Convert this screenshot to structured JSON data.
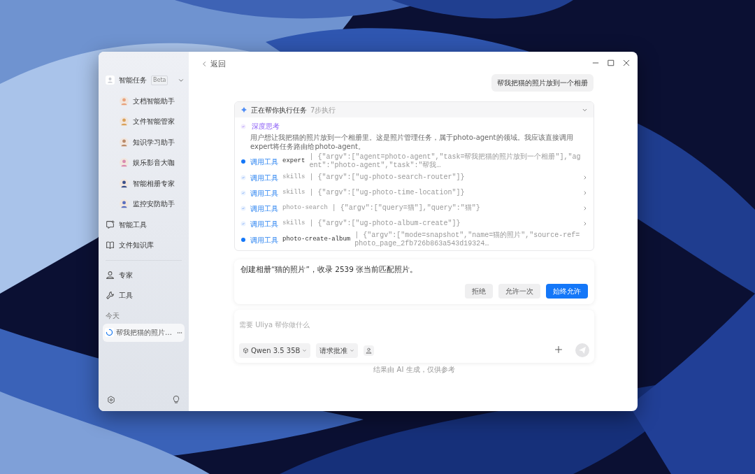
{
  "sidebar": {
    "header": {
      "label": "智能任务",
      "badge": "Beta",
      "expanded": true
    },
    "agents": [
      {
        "label": "文档智能助手",
        "color": "#e8a27c"
      },
      {
        "label": "文件智能管家",
        "color": "#d9a15a"
      },
      {
        "label": "知识学习助手",
        "color": "#b98a6a"
      },
      {
        "label": "娱乐影音大咖",
        "color": "#d98ab0"
      },
      {
        "label": "智能相册专家",
        "color": "#3a4f8a"
      },
      {
        "label": "监控安防助手",
        "color": "#5a6fc0"
      }
    ],
    "links": [
      {
        "kind": "tools",
        "label": "智能工具"
      },
      {
        "kind": "library",
        "label": "文件知识库"
      }
    ],
    "nav": [
      {
        "kind": "experts",
        "label": "专家"
      },
      {
        "kind": "wrench",
        "label": "工具"
      }
    ],
    "section_label": "今天",
    "history": [
      {
        "label": "帮我把猫的照片…",
        "loading": true,
        "selected": true
      }
    ]
  },
  "back": "返回",
  "user_message": "帮我把猫的照片放到一个相册",
  "task": {
    "title": "正在帮你执行任务",
    "subtitle": "7步执行",
    "expanded": true,
    "thought": {
      "label": "深度思考",
      "text": "用户想让我把猫的照片放到一个相册里。这是照片管理任务，属于photo-agent的领域。我应该直接调用expert将任务路由给photo-agent。"
    },
    "steps": [
      {
        "kind": "running",
        "label": "调用工具",
        "command": "expert",
        "args": "| {\"argv\":[\"agent=photo-agent\",\"task=帮我把猫的照片放到一个相册\"],\"agent\":\"photo-agent\",\"task\":\"帮我…",
        "expandable": false
      },
      {
        "kind": "done",
        "label": "调用工具",
        "command": "skills",
        "args": "| {\"argv\":[\"ug-photo-search-router\"]}",
        "expandable": true
      },
      {
        "kind": "done",
        "label": "调用工具",
        "command": "skills",
        "args": "| {\"argv\":[\"ug-photo-time-location\"]}",
        "expandable": true
      },
      {
        "kind": "done",
        "label": "调用工具",
        "command": "photo-search",
        "args": "| {\"argv\":[\"query=猫\"],\"query\":\"猫\"}",
        "expandable": true
      },
      {
        "kind": "done",
        "label": "调用工具",
        "command": "skills",
        "args": "| {\"argv\":[\"ug-photo-album-create\"]}",
        "expandable": true
      },
      {
        "kind": "running",
        "label": "调用工具",
        "command": "photo-create-album",
        "args": "| {\"argv\":[\"mode=snapshot\",\"name=猫的照片\",\"source-ref=photo_page_2fb726b863a543d19324…",
        "expandable": false
      }
    ]
  },
  "approval": {
    "text": "创建相册“猫的照片”，收录 2539 张当前匹配照片。",
    "buttons": [
      {
        "kind": "secondary",
        "label": "拒绝"
      },
      {
        "kind": "secondary",
        "label": "允许一次"
      },
      {
        "kind": "primary",
        "label": "始终允许"
      }
    ]
  },
  "composer": {
    "placeholder": "需要 Uliya 帮你做什么",
    "model": "Qwen 3.5 35B",
    "mode": "请求批准"
  },
  "footer": "结果由 AI 生成，仅供参考"
}
